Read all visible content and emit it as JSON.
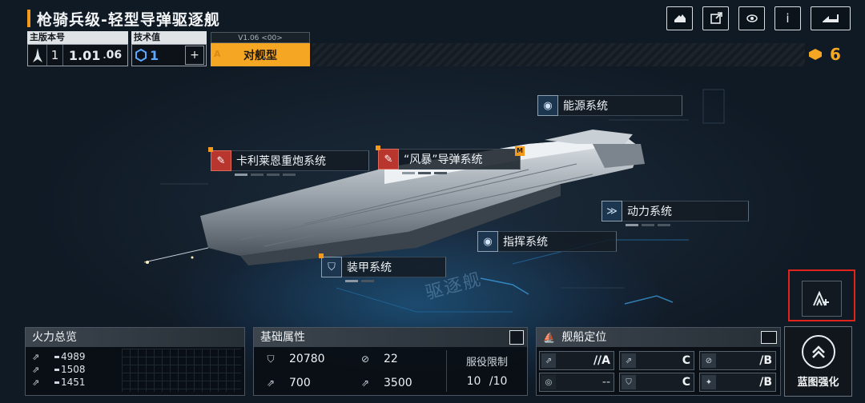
{
  "header": {
    "title": "枪骑兵级-轻型导弹驱逐舰",
    "icons": [
      "share-icon",
      "export-icon",
      "view-icon",
      "info-icon",
      "back-icon"
    ],
    "info_label": "i"
  },
  "info": {
    "main_version_label": "主版本号",
    "version_major": "1",
    "version_value": "1.01",
    "version_suffix": "06",
    "tech_label": "技术值",
    "tech_value": "1",
    "tech_add": "+",
    "class_version": "V1.06 <00>",
    "class_mark": "A",
    "class_type": "对舰型"
  },
  "currency": {
    "value": "6",
    "color": "#f5a623"
  },
  "systems": {
    "energy": "能源系统",
    "karilyon": "卡利莱恩重炮系统",
    "storm": "“风暴”导弹系统",
    "storm_badge": "M",
    "power": "动力系统",
    "command": "指挥系统",
    "armor": "装甲系统"
  },
  "watermark": "驱逐舰",
  "firepower": {
    "title": "火力总览",
    "rows": [
      "4989",
      "1508",
      "1451"
    ]
  },
  "attributes": {
    "title": "基础属性",
    "hp": "20780",
    "armor": "22",
    "speed": "700",
    "warp": "3500",
    "service_label": "服役限制",
    "service_current": "10",
    "service_max": "/10"
  },
  "positioning": {
    "title": "舰船定位",
    "cells": [
      {
        "grade": "//A"
      },
      {
        "grade": "C"
      },
      {
        "grade": "/B"
      },
      {
        "grade": "--"
      },
      {
        "grade": "C"
      },
      {
        "grade": "/B"
      }
    ]
  },
  "blueprint": {
    "label": "蓝图强化"
  },
  "accent": "#f39a1e"
}
